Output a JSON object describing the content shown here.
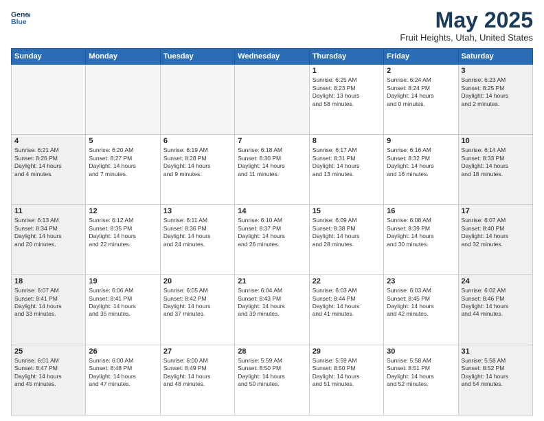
{
  "header": {
    "logo_line1": "General",
    "logo_line2": "Blue",
    "title": "May 2025",
    "subtitle": "Fruit Heights, Utah, United States"
  },
  "days_of_week": [
    "Sunday",
    "Monday",
    "Tuesday",
    "Wednesday",
    "Thursday",
    "Friday",
    "Saturday"
  ],
  "weeks": [
    [
      {
        "day": "",
        "empty": true
      },
      {
        "day": "",
        "empty": true
      },
      {
        "day": "",
        "empty": true
      },
      {
        "day": "",
        "empty": true
      },
      {
        "day": "1",
        "lines": [
          "Sunrise: 6:25 AM",
          "Sunset: 8:23 PM",
          "Daylight: 13 hours",
          "and 58 minutes."
        ]
      },
      {
        "day": "2",
        "lines": [
          "Sunrise: 6:24 AM",
          "Sunset: 8:24 PM",
          "Daylight: 14 hours",
          "and 0 minutes."
        ]
      },
      {
        "day": "3",
        "lines": [
          "Sunrise: 6:23 AM",
          "Sunset: 8:25 PM",
          "Daylight: 14 hours",
          "and 2 minutes."
        ]
      }
    ],
    [
      {
        "day": "4",
        "lines": [
          "Sunrise: 6:21 AM",
          "Sunset: 8:26 PM",
          "Daylight: 14 hours",
          "and 4 minutes."
        ]
      },
      {
        "day": "5",
        "lines": [
          "Sunrise: 6:20 AM",
          "Sunset: 8:27 PM",
          "Daylight: 14 hours",
          "and 7 minutes."
        ]
      },
      {
        "day": "6",
        "lines": [
          "Sunrise: 6:19 AM",
          "Sunset: 8:28 PM",
          "Daylight: 14 hours",
          "and 9 minutes."
        ]
      },
      {
        "day": "7",
        "lines": [
          "Sunrise: 6:18 AM",
          "Sunset: 8:30 PM",
          "Daylight: 14 hours",
          "and 11 minutes."
        ]
      },
      {
        "day": "8",
        "lines": [
          "Sunrise: 6:17 AM",
          "Sunset: 8:31 PM",
          "Daylight: 14 hours",
          "and 13 minutes."
        ]
      },
      {
        "day": "9",
        "lines": [
          "Sunrise: 6:16 AM",
          "Sunset: 8:32 PM",
          "Daylight: 14 hours",
          "and 16 minutes."
        ]
      },
      {
        "day": "10",
        "lines": [
          "Sunrise: 6:14 AM",
          "Sunset: 8:33 PM",
          "Daylight: 14 hours",
          "and 18 minutes."
        ]
      }
    ],
    [
      {
        "day": "11",
        "lines": [
          "Sunrise: 6:13 AM",
          "Sunset: 8:34 PM",
          "Daylight: 14 hours",
          "and 20 minutes."
        ]
      },
      {
        "day": "12",
        "lines": [
          "Sunrise: 6:12 AM",
          "Sunset: 8:35 PM",
          "Daylight: 14 hours",
          "and 22 minutes."
        ]
      },
      {
        "day": "13",
        "lines": [
          "Sunrise: 6:11 AM",
          "Sunset: 8:36 PM",
          "Daylight: 14 hours",
          "and 24 minutes."
        ]
      },
      {
        "day": "14",
        "lines": [
          "Sunrise: 6:10 AM",
          "Sunset: 8:37 PM",
          "Daylight: 14 hours",
          "and 26 minutes."
        ]
      },
      {
        "day": "15",
        "lines": [
          "Sunrise: 6:09 AM",
          "Sunset: 8:38 PM",
          "Daylight: 14 hours",
          "and 28 minutes."
        ]
      },
      {
        "day": "16",
        "lines": [
          "Sunrise: 6:08 AM",
          "Sunset: 8:39 PM",
          "Daylight: 14 hours",
          "and 30 minutes."
        ]
      },
      {
        "day": "17",
        "lines": [
          "Sunrise: 6:07 AM",
          "Sunset: 8:40 PM",
          "Daylight: 14 hours",
          "and 32 minutes."
        ]
      }
    ],
    [
      {
        "day": "18",
        "lines": [
          "Sunrise: 6:07 AM",
          "Sunset: 8:41 PM",
          "Daylight: 14 hours",
          "and 33 minutes."
        ]
      },
      {
        "day": "19",
        "lines": [
          "Sunrise: 6:06 AM",
          "Sunset: 8:41 PM",
          "Daylight: 14 hours",
          "and 35 minutes."
        ]
      },
      {
        "day": "20",
        "lines": [
          "Sunrise: 6:05 AM",
          "Sunset: 8:42 PM",
          "Daylight: 14 hours",
          "and 37 minutes."
        ]
      },
      {
        "day": "21",
        "lines": [
          "Sunrise: 6:04 AM",
          "Sunset: 8:43 PM",
          "Daylight: 14 hours",
          "and 39 minutes."
        ]
      },
      {
        "day": "22",
        "lines": [
          "Sunrise: 6:03 AM",
          "Sunset: 8:44 PM",
          "Daylight: 14 hours",
          "and 41 minutes."
        ]
      },
      {
        "day": "23",
        "lines": [
          "Sunrise: 6:03 AM",
          "Sunset: 8:45 PM",
          "Daylight: 14 hours",
          "and 42 minutes."
        ]
      },
      {
        "day": "24",
        "lines": [
          "Sunrise: 6:02 AM",
          "Sunset: 8:46 PM",
          "Daylight: 14 hours",
          "and 44 minutes."
        ]
      }
    ],
    [
      {
        "day": "25",
        "lines": [
          "Sunrise: 6:01 AM",
          "Sunset: 8:47 PM",
          "Daylight: 14 hours",
          "and 45 minutes."
        ]
      },
      {
        "day": "26",
        "lines": [
          "Sunrise: 6:00 AM",
          "Sunset: 8:48 PM",
          "Daylight: 14 hours",
          "and 47 minutes."
        ]
      },
      {
        "day": "27",
        "lines": [
          "Sunrise: 6:00 AM",
          "Sunset: 8:49 PM",
          "Daylight: 14 hours",
          "and 48 minutes."
        ]
      },
      {
        "day": "28",
        "lines": [
          "Sunrise: 5:59 AM",
          "Sunset: 8:50 PM",
          "Daylight: 14 hours",
          "and 50 minutes."
        ]
      },
      {
        "day": "29",
        "lines": [
          "Sunrise: 5:59 AM",
          "Sunset: 8:50 PM",
          "Daylight: 14 hours",
          "and 51 minutes."
        ]
      },
      {
        "day": "30",
        "lines": [
          "Sunrise: 5:58 AM",
          "Sunset: 8:51 PM",
          "Daylight: 14 hours",
          "and 52 minutes."
        ]
      },
      {
        "day": "31",
        "lines": [
          "Sunrise: 5:58 AM",
          "Sunset: 8:52 PM",
          "Daylight: 14 hours",
          "and 54 minutes."
        ]
      }
    ]
  ]
}
